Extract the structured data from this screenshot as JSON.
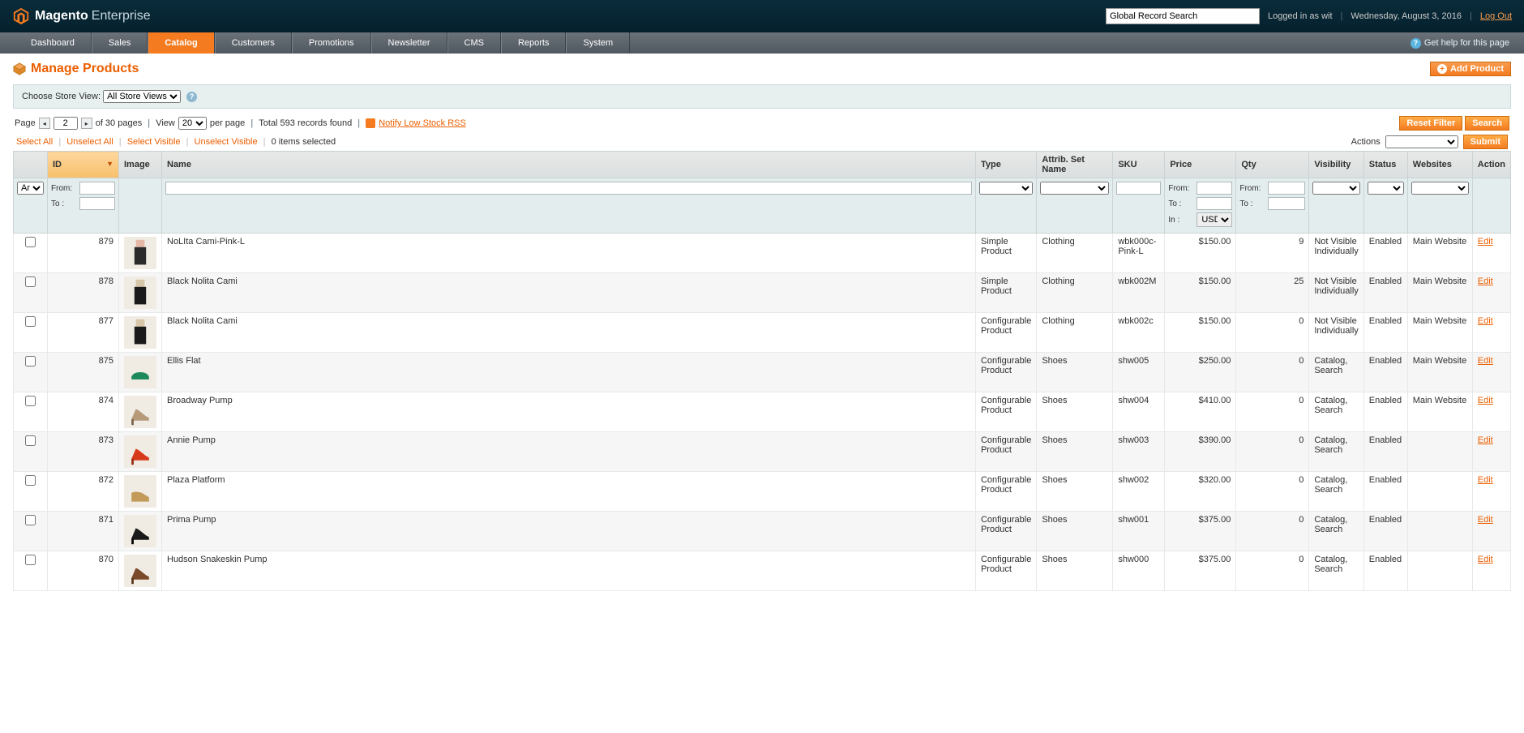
{
  "header": {
    "brand": "Magento",
    "edition": "Enterprise",
    "search_placeholder": "Global Record Search",
    "logged_in": "Logged in as wit",
    "date": "Wednesday, August 3, 2016",
    "logout": "Log Out"
  },
  "nav": {
    "items": [
      "Dashboard",
      "Sales",
      "Catalog",
      "Customers",
      "Promotions",
      "Newsletter",
      "CMS",
      "Reports",
      "System"
    ],
    "active_index": 2,
    "help": "Get help for this page"
  },
  "page": {
    "title": "Manage Products",
    "add_button": "Add Product"
  },
  "storeview": {
    "label": "Choose Store View:",
    "selected": "All Store Views"
  },
  "pager": {
    "page_label": "Page",
    "page_value": "2",
    "of_pages": "of 30 pages",
    "view_label": "View",
    "per_page_value": "20",
    "per_page_label": "per page",
    "total": "Total 593 records found",
    "rss_link": "Notify Low Stock RSS",
    "reset_filter": "Reset Filter",
    "search": "Search"
  },
  "massaction": {
    "select_all": "Select All",
    "unselect_all": "Unselect All",
    "select_visible": "Select Visible",
    "unselect_visible": "Unselect Visible",
    "items_selected": "0 items selected",
    "actions_label": "Actions",
    "submit": "Submit"
  },
  "columns": {
    "chk": "",
    "id": "ID",
    "image": "Image",
    "name": "Name",
    "type": "Type",
    "aset": "Attrib. Set Name",
    "sku": "SKU",
    "price": "Price",
    "qty": "Qty",
    "visibility": "Visibility",
    "status": "Status",
    "websites": "Websites",
    "action": "Action"
  },
  "filter": {
    "any": "Any",
    "from": "From:",
    "to": "To :",
    "in": "In :",
    "currency": "USD"
  },
  "rows": [
    {
      "id": "879",
      "name": "NoLIta Cami-Pink-L",
      "type": "Simple Product",
      "aset": "Clothing",
      "sku": "wbk000c-Pink-L",
      "price": "$150.00",
      "qty": "9",
      "vis": "Not Visible Individually",
      "status": "Enabled",
      "web": "Main Website",
      "edit": "Edit",
      "icon": "top-pink"
    },
    {
      "id": "878",
      "name": "Black Nolita Cami",
      "type": "Simple Product",
      "aset": "Clothing",
      "sku": "wbk002M",
      "price": "$150.00",
      "qty": "25",
      "vis": "Not Visible Individually",
      "status": "Enabled",
      "web": "Main Website",
      "edit": "Edit",
      "icon": "top-black"
    },
    {
      "id": "877",
      "name": "Black Nolita Cami",
      "type": "Configurable Product",
      "aset": "Clothing",
      "sku": "wbk002c",
      "price": "$150.00",
      "qty": "0",
      "vis": "Not Visible Individually",
      "status": "Enabled",
      "web": "Main Website",
      "edit": "Edit",
      "icon": "top-black"
    },
    {
      "id": "875",
      "name": "Ellis Flat",
      "type": "Configurable Product",
      "aset": "Shoes",
      "sku": "shw005",
      "price": "$250.00",
      "qty": "0",
      "vis": "Catalog, Search",
      "status": "Enabled",
      "web": "Main Website",
      "edit": "Edit",
      "icon": "flat-green"
    },
    {
      "id": "874",
      "name": "Broadway Pump",
      "type": "Configurable Product",
      "aset": "Shoes",
      "sku": "shw004",
      "price": "$410.00",
      "qty": "0",
      "vis": "Catalog, Search",
      "status": "Enabled",
      "web": "Main Website",
      "edit": "Edit",
      "icon": "pump-pattern"
    },
    {
      "id": "873",
      "name": "Annie Pump",
      "type": "Configurable Product",
      "aset": "Shoes",
      "sku": "shw003",
      "price": "$390.00",
      "qty": "0",
      "vis": "Catalog, Search",
      "status": "Enabled",
      "web": "",
      "edit": "Edit",
      "icon": "pump-red"
    },
    {
      "id": "872",
      "name": "Plaza Platform",
      "type": "Configurable Product",
      "aset": "Shoes",
      "sku": "shw002",
      "price": "$320.00",
      "qty": "0",
      "vis": "Catalog, Search",
      "status": "Enabled",
      "web": "",
      "edit": "Edit",
      "icon": "wedge-tan"
    },
    {
      "id": "871",
      "name": "Prima Pump",
      "type": "Configurable Product",
      "aset": "Shoes",
      "sku": "shw001",
      "price": "$375.00",
      "qty": "0",
      "vis": "Catalog, Search",
      "status": "Enabled",
      "web": "",
      "edit": "Edit",
      "icon": "pump-black"
    },
    {
      "id": "870",
      "name": "Hudson Snakeskin Pump",
      "type": "Configurable Product",
      "aset": "Shoes",
      "sku": "shw000",
      "price": "$375.00",
      "qty": "0",
      "vis": "Catalog, Search",
      "status": "Enabled",
      "web": "",
      "edit": "Edit",
      "icon": "pump-brown"
    }
  ]
}
